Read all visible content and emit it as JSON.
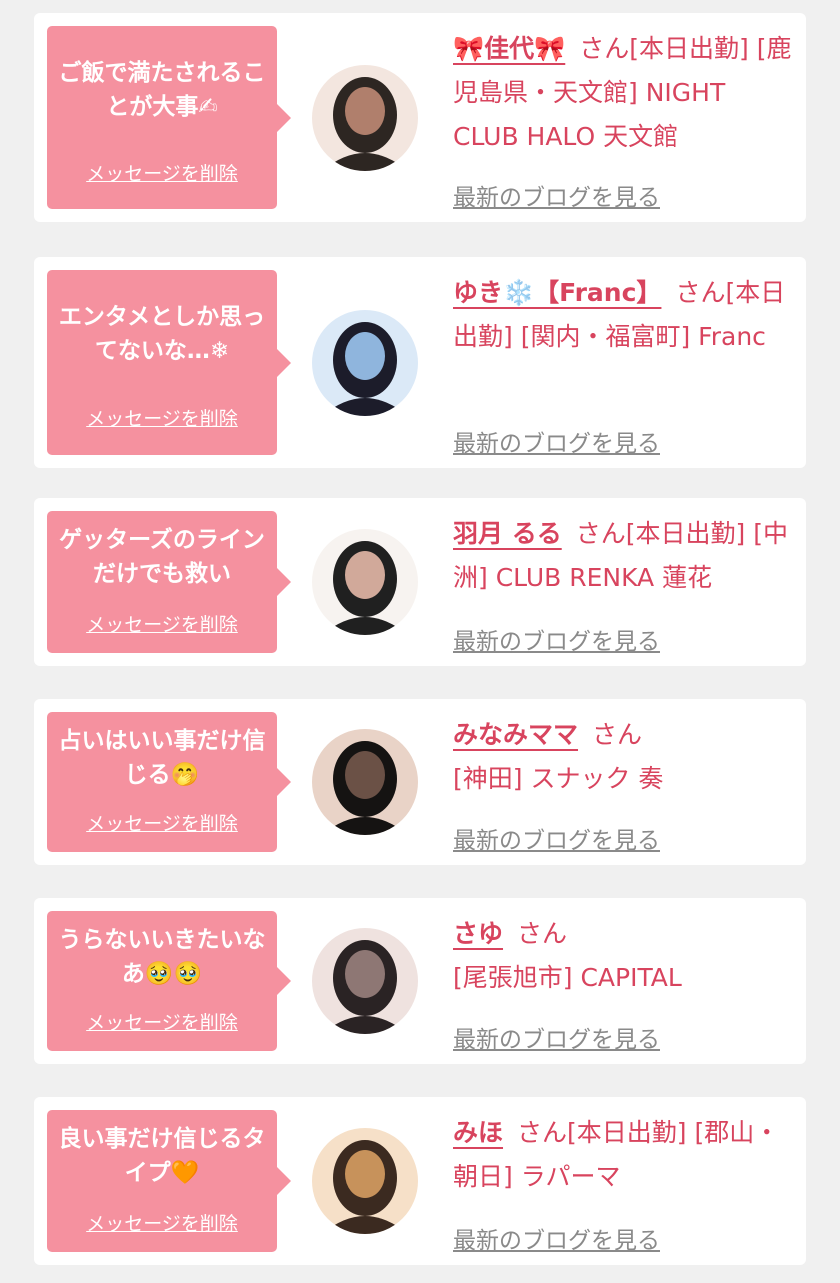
{
  "colors": {
    "page_background": "#f0f0f0",
    "card_background": "#ffffff",
    "bubble_pink": "#f5919f",
    "name_pink": "#d8445e",
    "blog_link_gray": "#8a8a8a"
  },
  "delete_label": "メッセージを削除",
  "blog_label": "最新のブログを見る",
  "entries": [
    {
      "message": "ご飯で満たされることが大事✍",
      "name": "🎀佳代🎀",
      "honorific": "さん",
      "detail": "[本日出勤] [鹿児島県・天文館] NIGHT CLUB HALO 天文館",
      "avatar_icon": "woman-portrait-icon",
      "avatar_colors": [
        "#f3e6df",
        "#b07f6c",
        "#2d2622"
      ]
    },
    {
      "message": "エンタメとしか思ってないな…❄",
      "name": "ゆき❄️【Franc】",
      "honorific": "さん",
      "detail": "[本日出勤] [関内・福富町] Franc",
      "avatar_icon": "woman-portrait-icon",
      "avatar_colors": [
        "#dbe9f7",
        "#8fb5dd",
        "#1c1c2a"
      ]
    },
    {
      "message": "ゲッターズのラインだけでも救い",
      "name": "羽月 るる",
      "honorific": "さん",
      "detail": "[本日出勤] [中洲] CLUB RENKA 蓮花",
      "avatar_icon": "woman-portrait-icon",
      "avatar_colors": [
        "#f7f3f0",
        "#d1a99a",
        "#202020"
      ]
    },
    {
      "message": "占いはいい事だけ信じる🤭",
      "name": "みなみママ",
      "honorific": "さん",
      "detail": "[神田] スナック 奏",
      "avatar_icon": "woman-portrait-icon",
      "avatar_colors": [
        "#e9d3c7",
        "#6b5146",
        "#151312"
      ]
    },
    {
      "message": "うらないいきたいなあ🥹🥹",
      "name": "さゆ",
      "honorific": "さん",
      "detail": "[尾張旭市] CAPITAL",
      "avatar_icon": "woman-portrait-icon",
      "avatar_colors": [
        "#efe2df",
        "#8e7774",
        "#2a2324"
      ]
    },
    {
      "message": "良い事だけ信じるタイプ🧡",
      "name": "みほ",
      "honorific": "さん",
      "detail": "[本日出勤] [郡山・朝日] ラパーマ",
      "avatar_icon": "woman-portrait-icon",
      "avatar_colors": [
        "#f6e0c8",
        "#c7925b",
        "#3b2a20"
      ]
    }
  ]
}
